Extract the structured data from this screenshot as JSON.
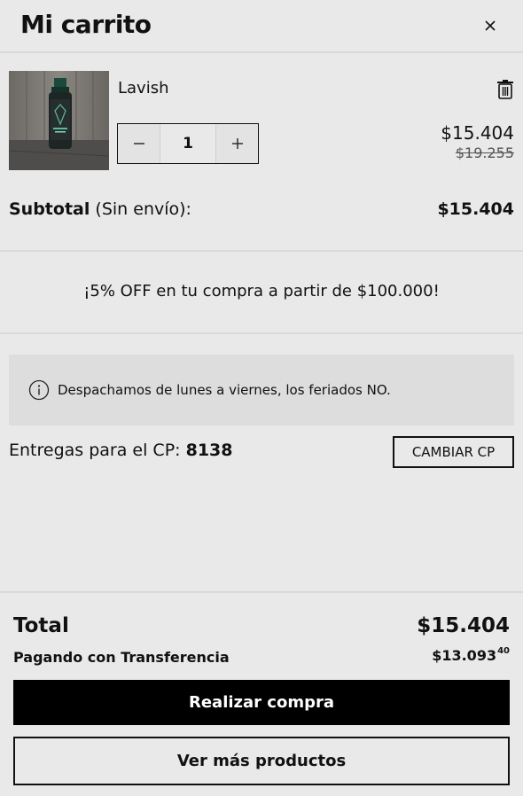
{
  "header": {
    "title": "Mi carrito",
    "close_icon": "close-icon"
  },
  "cart": {
    "items": [
      {
        "name": "Lavish",
        "quantity": "1",
        "price": "$15.404",
        "original_price": "$19.255",
        "thumbnail_icon": "product-bottle-image",
        "delete_icon": "trash-icon",
        "decrease_icon": "minus-icon",
        "increase_icon": "plus-icon"
      }
    ]
  },
  "subtotal": {
    "label_bold": "Subtotal",
    "label_rest": " (Sin envío):",
    "value": "$15.404"
  },
  "promo": {
    "text": "¡5% OFF en tu compra a partir de $100.000!"
  },
  "info": {
    "icon": "info-icon",
    "text": "Despachamos de lunes a viernes, los feriados NO."
  },
  "shipping": {
    "label": "Entregas para el CP: ",
    "postal_code": "8138",
    "change_button": "CAMBIAR CP"
  },
  "totals": {
    "total_label": "Total",
    "total_value": "$15.404",
    "transfer_label": "Pagando con Transferencia",
    "transfer_value": "$13.093",
    "transfer_cents": "40"
  },
  "actions": {
    "checkout_label": "Realizar compra",
    "more_products_label": "Ver más productos"
  },
  "colors": {
    "background": "#e9e9e9",
    "primary_button": "#000000",
    "info_box": "#dddddd"
  }
}
